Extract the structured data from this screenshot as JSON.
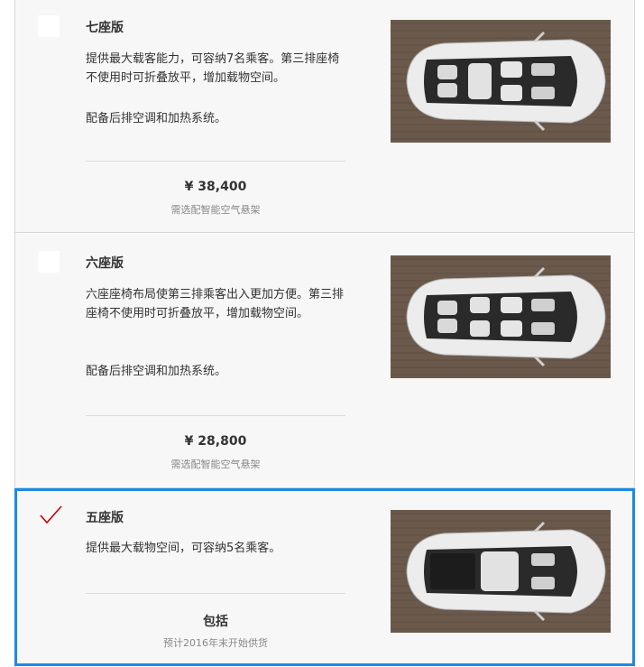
{
  "options": [
    {
      "title": "七座版",
      "description": "提供最大载客能力，可容纳7名乘客。第三排座椅不使用时可折叠放平，增加载物空间。",
      "description_extra": "配备后排空调和加热系统。",
      "price": "¥ 38,400",
      "note": "需选配智能空气悬架",
      "selected": false,
      "image_icon": "seven-seat-interior-image"
    },
    {
      "title": "六座版",
      "description": "六座座椅布局使第三排乘客出入更加方便。第三排座椅不使用时可折叠放平，增加载物空间。",
      "description_extra": "配备后排空调和加热系统。",
      "price": "¥ 28,800",
      "note": "需选配智能空气悬架",
      "selected": false,
      "image_icon": "six-seat-interior-image"
    },
    {
      "title": "五座版",
      "description": "提供最大载物空间，可容纳5名乘客。",
      "price": "包括",
      "note": "预计2016年末开始供货",
      "selected": true,
      "image_icon": "five-seat-interior-image"
    }
  ],
  "colors": {
    "selected_outline": "#1a8ae5",
    "check_mark": "#cc0000",
    "panel_background": "#f7f7f7"
  }
}
